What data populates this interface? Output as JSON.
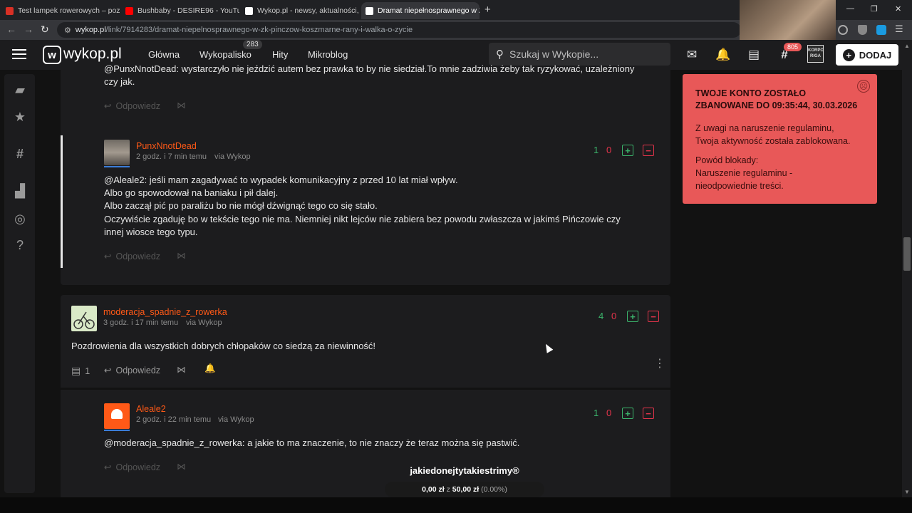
{
  "browser": {
    "tabs": [
      {
        "title": "Test lampek rowerowych – pozn",
        "fav_color": "#d93025"
      },
      {
        "title": "Bushbaby - DESIRE96 - YouTube",
        "fav_color": "#ff0000"
      },
      {
        "title": "Wykop.pl - newsy, aktualności, g",
        "fav_color": "#ffffff"
      },
      {
        "title": "Dramat niepełnosprawnego w Z",
        "fav_color": "#ffffff"
      }
    ],
    "new_tab_label": "+",
    "url_host": "wykop.pl",
    "url_path": "/link/7914283/dramat-niepelnosprawnego-w-zk-pinczow-koszmarne-rany-i-walka-o-zycie",
    "window_controls": [
      "—",
      "❐",
      "✕"
    ]
  },
  "header": {
    "logo_text": "wykop.pl",
    "nav": [
      "Główna",
      "Wykopalisko",
      "Hity",
      "Mikroblog"
    ],
    "wykopalisko_badge": "283",
    "search_placeholder": "Szukaj w Wykopie...",
    "tag_badge": "805",
    "avatar_label": "KORPO RIGA",
    "add_button": "DODAJ"
  },
  "comments": {
    "top_partial": {
      "text_line1": "@PunxNnotDead: wystarczyło nie jeździć autem bez prawka to by nie siedział.To mnie zadziwia żeby tak ryzykować, uzależniony",
      "text_line2": "czy jak.",
      "reply_label": "Odpowiedz"
    },
    "c1": {
      "author": "PunxNnotDead",
      "time": "2 godz. i 7 min temu",
      "via": "via Wykop",
      "votes_up": "1",
      "votes_down": "0",
      "lines": [
        {
          "mention": "@Aleale2",
          "text": ": jeśli mam zagadywać to wypadek komunikacyjny z przed 10 lat miał wpływ."
        },
        {
          "mention": "",
          "text": "Albo go spowodował na baniaku i pił dalej."
        },
        {
          "mention": "",
          "text": "Albo zaczął pić po paraliżu bo nie mógł dźwignąć tego co się stało."
        },
        {
          "mention": "",
          "text": "Oczywiście zgaduję bo w tekście tego nie ma. Niemniej nikt lejców nie zabiera bez powodu zwłaszcza w jakimś Pińczowie czy"
        },
        {
          "mention": "",
          "text": "innej wiosce tego typu."
        }
      ],
      "reply_label": "Odpowiedz"
    },
    "c2": {
      "author": "moderacja_spadnie_z_rowerka",
      "time": "3 godz. i 17 min temu",
      "via": "via Wykop",
      "votes_up": "4",
      "votes_down": "0",
      "text": "Pozdrowienia dla wszystkich dobrych chłopaków co siedzą za niewinność!",
      "reply_count": "1",
      "reply_label": "Odpowiedz"
    },
    "c3": {
      "author": "Aleale2",
      "time": "2 godz. i 22 min temu",
      "via": "via Wykop",
      "votes_up": "1",
      "votes_down": "0",
      "mention": "@moderacja_spadnie_z_rowerka",
      "text": ": a jakie to ma znaczenie, to nie znaczy że teraz można się pastwić.",
      "reply_label": "Odpowiedz"
    }
  },
  "ban": {
    "title": "TWOJE KONTO ZOSTAŁO ZBANOWANE DO 09:35:44, 30.03.2026",
    "line1": "Z uwagi na naruszenie regulaminu,",
    "line2": "Twoja aktywność została zablokowana.",
    "reason_label": "Powód blokady:",
    "reason1": "Naruszenie regulaminu -",
    "reason2": "nieodpowiednie treści."
  },
  "overlay": {
    "stream_name": "jakiedonejtytakiestrimy®",
    "donation_current": "0,00 zł",
    "donation_sep": "z",
    "donation_goal": "50,00 zł",
    "donation_pct": "(0.00%)"
  },
  "colors": {
    "accent": "#ff5917",
    "vote_up": "#3bb36b",
    "vote_down": "#e3344b",
    "ban_bg": "#e85858"
  }
}
